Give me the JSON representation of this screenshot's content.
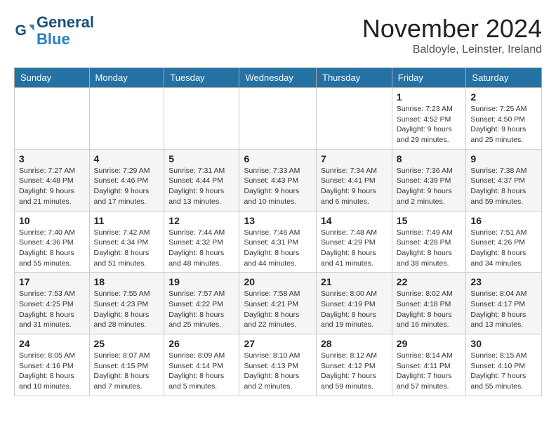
{
  "logo": {
    "line1": "General",
    "line2": "Blue"
  },
  "title": "November 2024",
  "subtitle": "Baldoyle, Leinster, Ireland",
  "headers": [
    "Sunday",
    "Monday",
    "Tuesday",
    "Wednesday",
    "Thursday",
    "Friday",
    "Saturday"
  ],
  "weeks": [
    [
      {
        "day": "",
        "info": ""
      },
      {
        "day": "",
        "info": ""
      },
      {
        "day": "",
        "info": ""
      },
      {
        "day": "",
        "info": ""
      },
      {
        "day": "",
        "info": ""
      },
      {
        "day": "1",
        "info": "Sunrise: 7:23 AM\nSunset: 4:52 PM\nDaylight: 9 hours and 29 minutes."
      },
      {
        "day": "2",
        "info": "Sunrise: 7:25 AM\nSunset: 4:50 PM\nDaylight: 9 hours and 25 minutes."
      }
    ],
    [
      {
        "day": "3",
        "info": "Sunrise: 7:27 AM\nSunset: 4:48 PM\nDaylight: 9 hours and 21 minutes."
      },
      {
        "day": "4",
        "info": "Sunrise: 7:29 AM\nSunset: 4:46 PM\nDaylight: 9 hours and 17 minutes."
      },
      {
        "day": "5",
        "info": "Sunrise: 7:31 AM\nSunset: 4:44 PM\nDaylight: 9 hours and 13 minutes."
      },
      {
        "day": "6",
        "info": "Sunrise: 7:33 AM\nSunset: 4:43 PM\nDaylight: 9 hours and 10 minutes."
      },
      {
        "day": "7",
        "info": "Sunrise: 7:34 AM\nSunset: 4:41 PM\nDaylight: 9 hours and 6 minutes."
      },
      {
        "day": "8",
        "info": "Sunrise: 7:36 AM\nSunset: 4:39 PM\nDaylight: 9 hours and 2 minutes."
      },
      {
        "day": "9",
        "info": "Sunrise: 7:38 AM\nSunset: 4:37 PM\nDaylight: 8 hours and 59 minutes."
      }
    ],
    [
      {
        "day": "10",
        "info": "Sunrise: 7:40 AM\nSunset: 4:36 PM\nDaylight: 8 hours and 55 minutes."
      },
      {
        "day": "11",
        "info": "Sunrise: 7:42 AM\nSunset: 4:34 PM\nDaylight: 8 hours and 51 minutes."
      },
      {
        "day": "12",
        "info": "Sunrise: 7:44 AM\nSunset: 4:32 PM\nDaylight: 8 hours and 48 minutes."
      },
      {
        "day": "13",
        "info": "Sunrise: 7:46 AM\nSunset: 4:31 PM\nDaylight: 8 hours and 44 minutes."
      },
      {
        "day": "14",
        "info": "Sunrise: 7:48 AM\nSunset: 4:29 PM\nDaylight: 8 hours and 41 minutes."
      },
      {
        "day": "15",
        "info": "Sunrise: 7:49 AM\nSunset: 4:28 PM\nDaylight: 8 hours and 38 minutes."
      },
      {
        "day": "16",
        "info": "Sunrise: 7:51 AM\nSunset: 4:26 PM\nDaylight: 8 hours and 34 minutes."
      }
    ],
    [
      {
        "day": "17",
        "info": "Sunrise: 7:53 AM\nSunset: 4:25 PM\nDaylight: 8 hours and 31 minutes."
      },
      {
        "day": "18",
        "info": "Sunrise: 7:55 AM\nSunset: 4:23 PM\nDaylight: 8 hours and 28 minutes."
      },
      {
        "day": "19",
        "info": "Sunrise: 7:57 AM\nSunset: 4:22 PM\nDaylight: 8 hours and 25 minutes."
      },
      {
        "day": "20",
        "info": "Sunrise: 7:58 AM\nSunset: 4:21 PM\nDaylight: 8 hours and 22 minutes."
      },
      {
        "day": "21",
        "info": "Sunrise: 8:00 AM\nSunset: 4:19 PM\nDaylight: 8 hours and 19 minutes."
      },
      {
        "day": "22",
        "info": "Sunrise: 8:02 AM\nSunset: 4:18 PM\nDaylight: 8 hours and 16 minutes."
      },
      {
        "day": "23",
        "info": "Sunrise: 8:04 AM\nSunset: 4:17 PM\nDaylight: 8 hours and 13 minutes."
      }
    ],
    [
      {
        "day": "24",
        "info": "Sunrise: 8:05 AM\nSunset: 4:16 PM\nDaylight: 8 hours and 10 minutes."
      },
      {
        "day": "25",
        "info": "Sunrise: 8:07 AM\nSunset: 4:15 PM\nDaylight: 8 hours and 7 minutes."
      },
      {
        "day": "26",
        "info": "Sunrise: 8:09 AM\nSunset: 4:14 PM\nDaylight: 8 hours and 5 minutes."
      },
      {
        "day": "27",
        "info": "Sunrise: 8:10 AM\nSunset: 4:13 PM\nDaylight: 8 hours and 2 minutes."
      },
      {
        "day": "28",
        "info": "Sunrise: 8:12 AM\nSunset: 4:12 PM\nDaylight: 7 hours and 59 minutes."
      },
      {
        "day": "29",
        "info": "Sunrise: 8:14 AM\nSunset: 4:11 PM\nDaylight: 7 hours and 57 minutes."
      },
      {
        "day": "30",
        "info": "Sunrise: 8:15 AM\nSunset: 4:10 PM\nDaylight: 7 hours and 55 minutes."
      }
    ]
  ]
}
